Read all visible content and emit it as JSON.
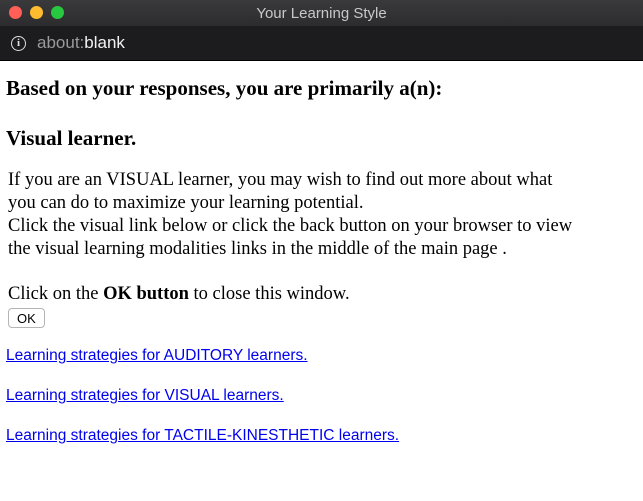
{
  "window": {
    "title": "Your Learning Style"
  },
  "urlbar": {
    "scheme": "about:",
    "host": "blank"
  },
  "main": {
    "heading_primary": "Based on your responses, you are primarily a(n):",
    "heading_result": "Visual learner.",
    "paragraph_lines": [
      "If you are an VISUAL learner, you may wish to find out more about what",
      "you can do to maximize your learning potential.",
      "Click the visual link below or click the back button on your browser to view",
      "the visual learning modalities links in the middle of the main page ."
    ],
    "close_prefix": "Click on the ",
    "close_bold": "OK button",
    "close_suffix": " to close this window.",
    "ok_label": "OK",
    "links": [
      "Learning strategies for AUDITORY learners.",
      "Learning strategies for VISUAL learners.",
      "Learning strategies for TACTILE-KINESTHETIC learners."
    ]
  },
  "colors": {
    "link": "#0000ee",
    "titlebar": "#2c2c2e",
    "urlbar": "#1c1c1e"
  }
}
